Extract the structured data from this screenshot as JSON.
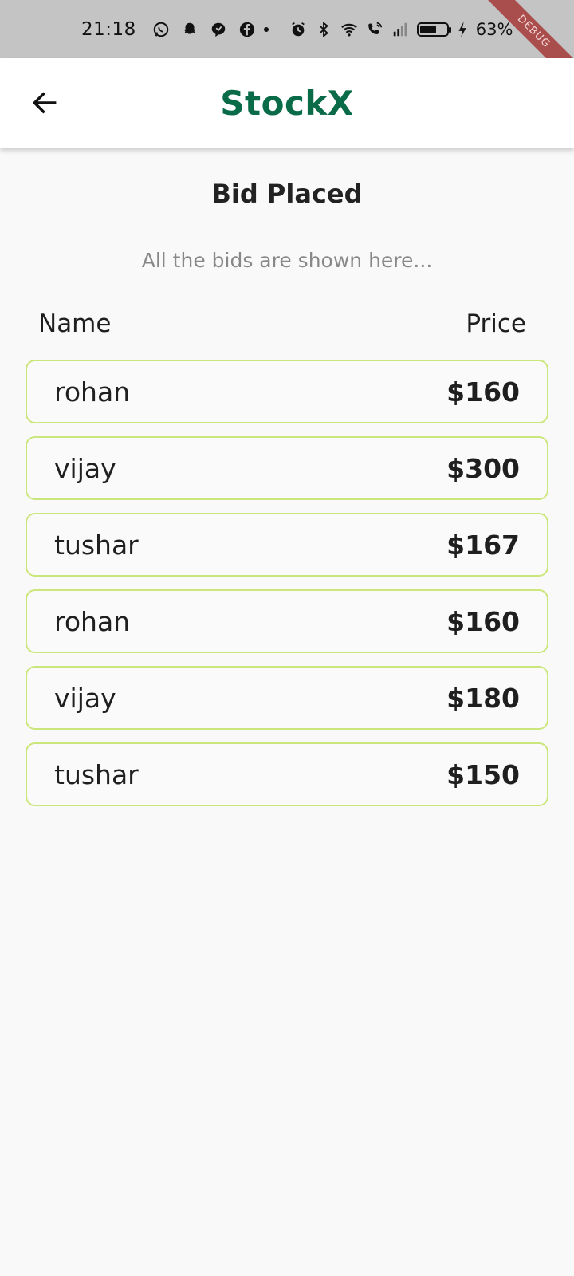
{
  "status_bar": {
    "time": "21:18",
    "battery_percent": "63%",
    "battery_level": 0.63,
    "icons": [
      "whatsapp-icon",
      "snapchat-icon",
      "chat-icon",
      "facebook-icon",
      "alarm-icon",
      "bluetooth-icon",
      "wifi-icon",
      "wifi-call-icon",
      "signal-icon",
      "battery-icon",
      "charging-icon"
    ]
  },
  "debug_banner": "DEBUG",
  "app_bar": {
    "logo": "StockX",
    "logo_color": "#0a6b48"
  },
  "page": {
    "title": "Bid Placed",
    "subtitle": "All the bids are shown here..."
  },
  "table": {
    "headers": {
      "name": "Name",
      "price": "Price"
    },
    "border_color": "#cbe67a",
    "rows": [
      {
        "name": "rohan",
        "price": "$160"
      },
      {
        "name": "vijay",
        "price": "$300"
      },
      {
        "name": "tushar",
        "price": "$167"
      },
      {
        "name": "rohan",
        "price": "$160"
      },
      {
        "name": "vijay",
        "price": "$180"
      },
      {
        "name": "tushar",
        "price": "$150"
      }
    ]
  }
}
